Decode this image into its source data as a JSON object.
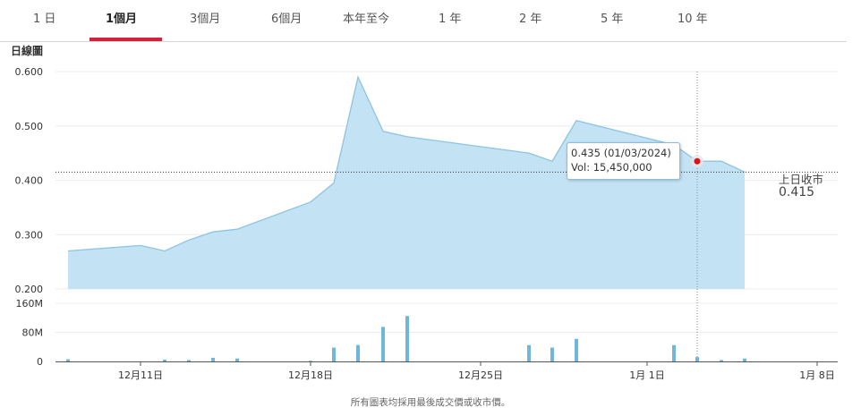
{
  "tabs": [
    {
      "label": "1 日",
      "active": false
    },
    {
      "label": "1個月",
      "active": true
    },
    {
      "label": "3個月",
      "active": false
    },
    {
      "label": "6個月",
      "active": false
    },
    {
      "label": "本年至今",
      "active": false
    },
    {
      "label": "1 年",
      "active": false
    },
    {
      "label": "2 年",
      "active": false
    },
    {
      "label": "5 年",
      "active": false
    },
    {
      "label": "10 年",
      "active": false
    }
  ],
  "chart_label": "日線圖",
  "tooltip": {
    "line1": "0.435 (01/03/2024)",
    "line2": "Vol: 15,450,000"
  },
  "prev_close": {
    "label": "上日收市",
    "value": "0.415"
  },
  "footnote": "所有圖表均採用最後成交價或收市價。",
  "colors": {
    "accent": "#d0223a",
    "area_fill": "#c3e3f5",
    "area_line": "#8cc4e2",
    "volume_bar": "#6fb7da",
    "marker": "#e0101a"
  },
  "chart_data": {
    "type": "area",
    "price_axis": {
      "ticks": [
        "0.600",
        "0.500",
        "0.400",
        "0.300",
        "0.200"
      ],
      "range": [
        0.2,
        0.6
      ]
    },
    "volume_axis": {
      "ticks": [
        "160M",
        "80M",
        "0"
      ],
      "range": [
        0,
        160
      ]
    },
    "x_ticks": [
      "12月11日",
      "12月18日",
      "12月25日",
      "1月 1日",
      "1月 8日"
    ],
    "dates": [
      "12/08",
      "12/11",
      "12/12",
      "12/13",
      "12/14",
      "12/15",
      "12/18",
      "12/19",
      "12/20",
      "12/21",
      "12/22",
      "12/27",
      "12/28",
      "12/29",
      "01/02",
      "01/03",
      "01/04",
      "01/05"
    ],
    "prices": [
      0.27,
      0.28,
      0.27,
      0.29,
      0.305,
      0.31,
      0.36,
      0.395,
      0.59,
      0.49,
      0.48,
      0.45,
      0.435,
      0.51,
      0.465,
      0.435,
      0.435,
      0.415
    ],
    "volumes_m": [
      6,
      0,
      5,
      4,
      10,
      8,
      2,
      38,
      45,
      95,
      125,
      45,
      38,
      62,
      45,
      12,
      4,
      8
    ],
    "previous_close": 0.415
  }
}
